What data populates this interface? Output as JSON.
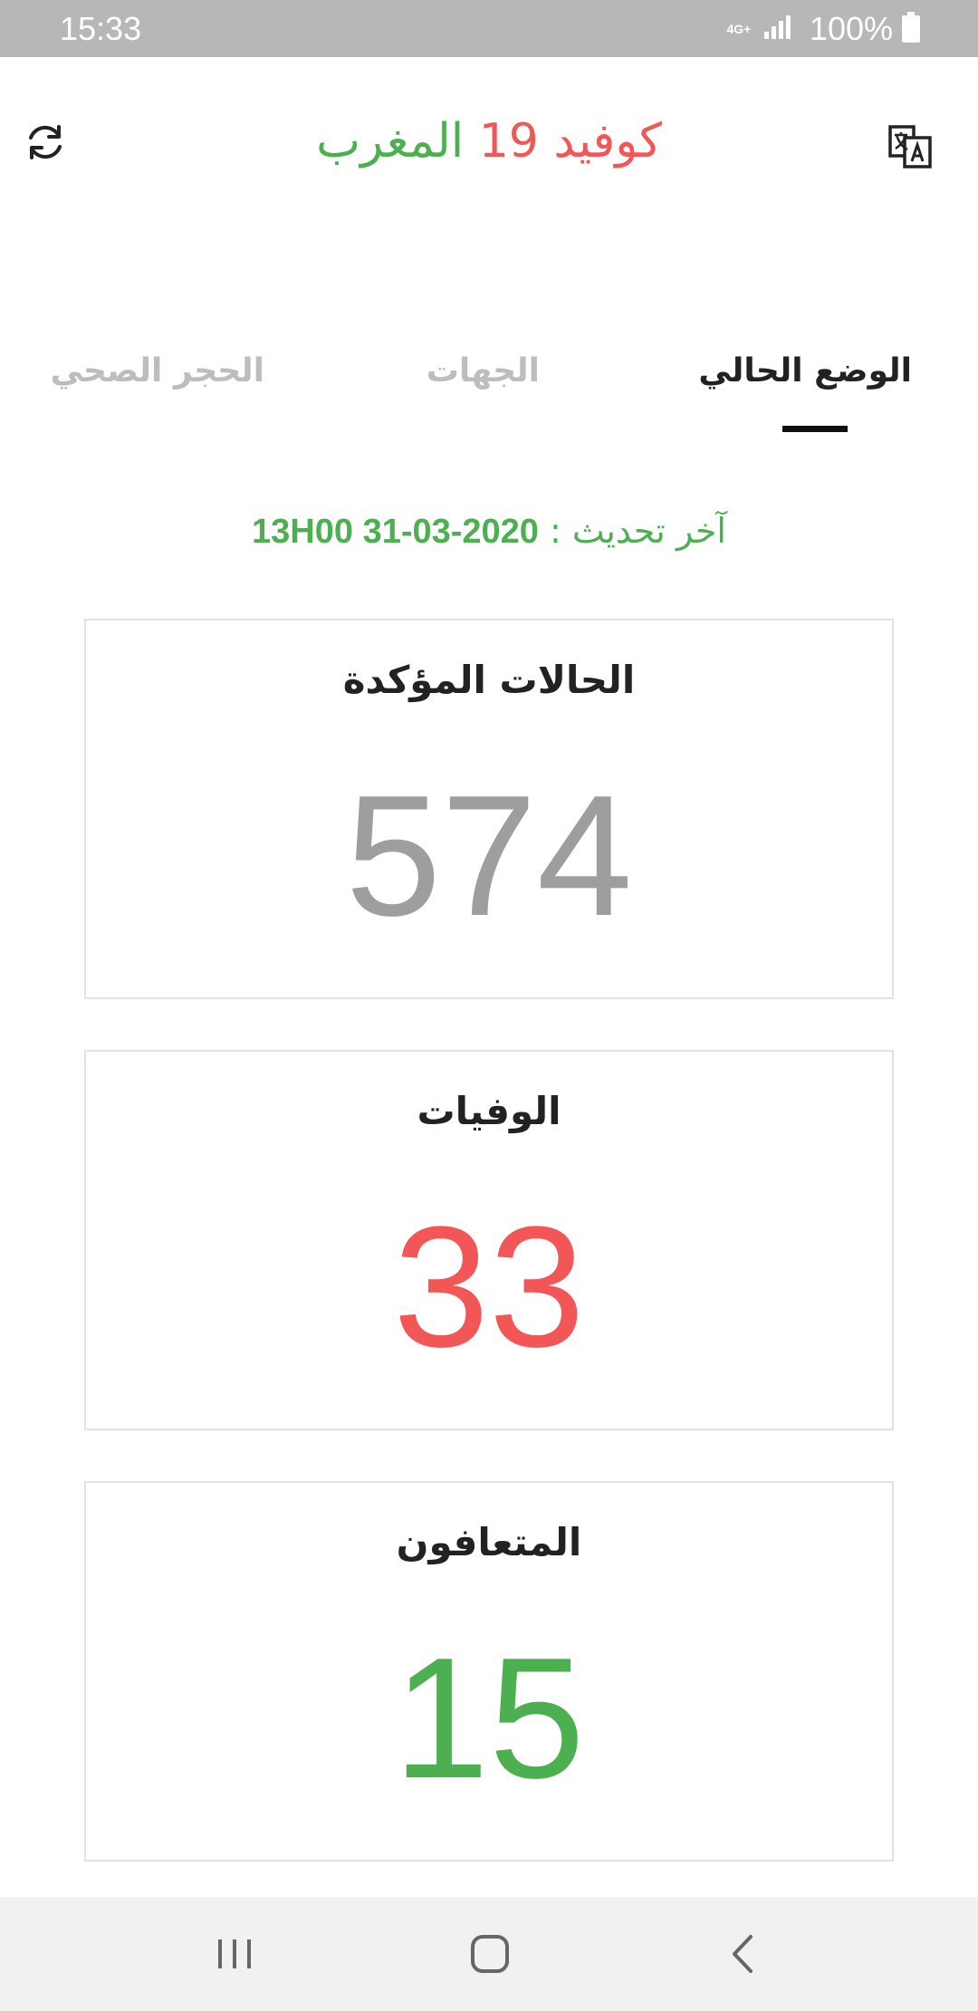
{
  "status_bar": {
    "time": "15:33",
    "network": "4G+",
    "battery": "100%"
  },
  "header": {
    "title_part1": "كوفيد",
    "title_number": "19",
    "title_part2": "المغرب"
  },
  "tabs": [
    {
      "label": "الوضع الحالي",
      "active": true
    },
    {
      "label": "الجهات",
      "active": false
    },
    {
      "label": "الحجر الصحي",
      "active": false
    }
  ],
  "last_update": {
    "label": "آخر تحديث :",
    "datetime": "13H00 31-03-2020"
  },
  "cards": {
    "confirmed": {
      "title": "الحالات المؤكدة",
      "value": "574"
    },
    "deaths": {
      "title": "الوفيات",
      "value": "33"
    },
    "recovered": {
      "title": "المتعافون",
      "value": "15"
    }
  },
  "colors": {
    "red": "#f25656",
    "green": "#4caf50",
    "gray": "#9e9e9e"
  }
}
